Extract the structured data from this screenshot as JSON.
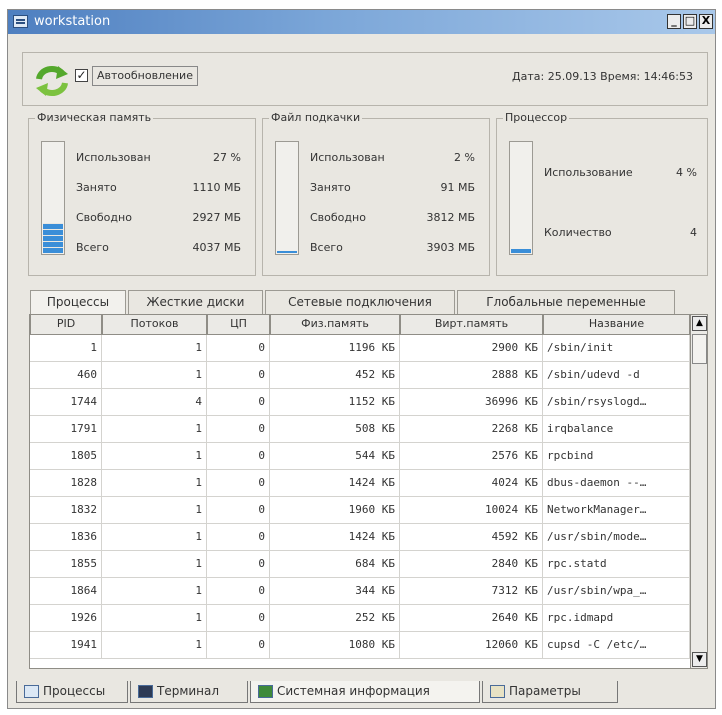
{
  "window": {
    "title": "workstation",
    "controls": [
      "_",
      "□",
      "X"
    ]
  },
  "toolbar": {
    "auto_refresh_checked": true,
    "auto_refresh_label": "Автообновление",
    "datetime": "Дата: 25.09.13  Время: 14:46:53"
  },
  "physical_memory": {
    "title": "Физическая память",
    "usage_percent": 27,
    "rows": [
      {
        "label": "Использован",
        "value": "27 %"
      },
      {
        "label": "Занято",
        "value": "1110 МБ"
      },
      {
        "label": "Свободно",
        "value": "2927 МБ"
      },
      {
        "label": "Всего",
        "value": "4037 МБ"
      }
    ]
  },
  "swap": {
    "title": "Файл подкачки",
    "usage_percent": 2,
    "rows": [
      {
        "label": "Использован",
        "value": "2 %"
      },
      {
        "label": "Занято",
        "value": "91 МБ"
      },
      {
        "label": "Свободно",
        "value": "3812 МБ"
      },
      {
        "label": "Всего",
        "value": "3903 МБ"
      }
    ]
  },
  "cpu": {
    "title": "Процессор",
    "usage_percent": 4,
    "rows": [
      {
        "label": "Использование",
        "value": "4 %"
      },
      {
        "label": "Количество",
        "value": "4"
      }
    ]
  },
  "tabs": [
    "Процессы",
    "Жесткие диски",
    "Сетевые подключения",
    "Глобальные переменные"
  ],
  "table": {
    "headers": [
      "PID",
      "Потоков",
      "ЦП",
      "Физ.память",
      "Вирт.память",
      "Название"
    ],
    "rows": [
      [
        "1",
        "1",
        "0",
        "1196 КБ",
        "2900 КБ",
        "/sbin/init"
      ],
      [
        "460",
        "1",
        "0",
        "452 КБ",
        "2888 КБ",
        "/sbin/udevd -d"
      ],
      [
        "1744",
        "4",
        "0",
        "1152 КБ",
        "36996 КБ",
        "/sbin/rsyslogd…"
      ],
      [
        "1791",
        "1",
        "0",
        "508 КБ",
        "2268 КБ",
        "irqbalance"
      ],
      [
        "1805",
        "1",
        "0",
        "544 КБ",
        "2576 КБ",
        "rpcbind"
      ],
      [
        "1828",
        "1",
        "0",
        "1424 КБ",
        "4024 КБ",
        "dbus-daemon --…"
      ],
      [
        "1832",
        "1",
        "0",
        "1960 КБ",
        "10024 КБ",
        "NetworkManager…"
      ],
      [
        "1836",
        "1",
        "0",
        "1424 КБ",
        "4592 КБ",
        "/usr/sbin/mode…"
      ],
      [
        "1855",
        "1",
        "0",
        "684 КБ",
        "2840 КБ",
        "rpc.statd"
      ],
      [
        "1864",
        "1",
        "0",
        "344 КБ",
        "7312 КБ",
        "/usr/sbin/wpa_…"
      ],
      [
        "1926",
        "1",
        "0",
        "252 КБ",
        "2640 КБ",
        "rpc.idmapd"
      ],
      [
        "1941",
        "1",
        "0",
        "1080 КБ",
        "12060 КБ",
        "cupsd -C /etc/…"
      ]
    ]
  },
  "bottom_tabs": [
    "Процессы",
    "Терминал",
    "Системная информация",
    "Параметры"
  ]
}
